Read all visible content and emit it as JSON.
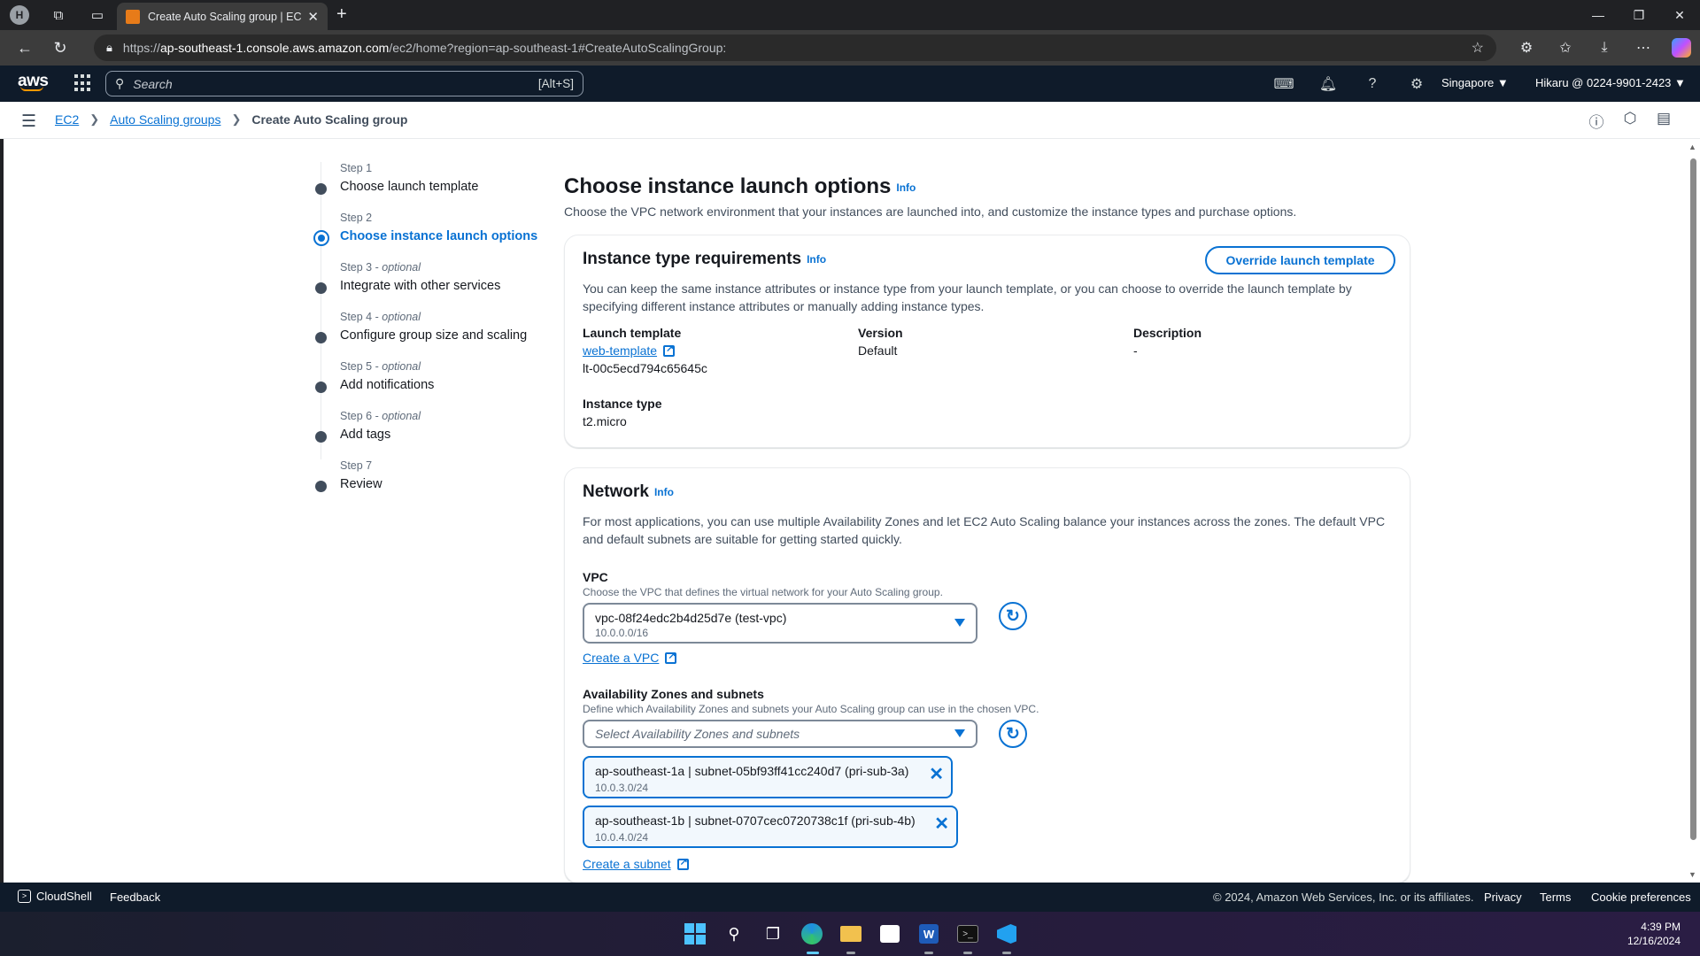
{
  "browser": {
    "tab_title": "Create Auto Scaling group | EC2 |",
    "url_prefix": "https://",
    "url_host": "ap-southeast-1.console.aws.amazon.com",
    "url_path": "/ec2/home?region=ap-southeast-1#CreateAutoScalingGroup:"
  },
  "aws_nav": {
    "logo": "aws",
    "search_placeholder": "Search",
    "search_shortcut": "[Alt+S]",
    "region": "Singapore ▼",
    "account": "Hikaru @ 0224-9901-2423 ▼"
  },
  "breadcrumb": {
    "items": [
      "EC2",
      "Auto Scaling groups"
    ],
    "current": "Create Auto Scaling group"
  },
  "steps": [
    {
      "num": "Step 1",
      "optional": "",
      "label": "Choose launch template",
      "active": false
    },
    {
      "num": "Step 2",
      "optional": "",
      "label": "Choose instance launch options",
      "active": true
    },
    {
      "num": "Step 3 - ",
      "optional": "optional",
      "label": "Integrate with other services",
      "active": false
    },
    {
      "num": "Step 4 - ",
      "optional": "optional",
      "label": "Configure group size and scaling",
      "active": false
    },
    {
      "num": "Step 5 - ",
      "optional": "optional",
      "label": "Add notifications",
      "active": false
    },
    {
      "num": "Step 6 - ",
      "optional": "optional",
      "label": "Add tags",
      "active": false
    },
    {
      "num": "Step 7",
      "optional": "",
      "label": "Review",
      "active": false
    }
  ],
  "page": {
    "title": "Choose instance launch options",
    "info": "Info",
    "subtitle": "Choose the VPC network environment that your instances are launched into, and customize the instance types and purchase options."
  },
  "instance_type": {
    "title": "Instance type requirements",
    "info": "Info",
    "override_button": "Override launch template",
    "description": "You can keep the same instance attributes or instance type from your launch template, or you can choose to override the launch template by specifying different instance attributes or manually adding instance types.",
    "launch_template_label": "Launch template",
    "launch_template_link": "web-template",
    "launch_template_id": "lt-00c5ecd794c65645c",
    "version_label": "Version",
    "version_value": "Default",
    "description_label": "Description",
    "description_value": "-",
    "instance_type_label": "Instance type",
    "instance_type_value": "t2.micro"
  },
  "network": {
    "title": "Network",
    "info": "Info",
    "description": "For most applications, you can use multiple Availability Zones and let EC2 Auto Scaling balance your instances across the zones. The default VPC and default subnets are suitable for getting started quickly.",
    "vpc_label": "VPC",
    "vpc_hint": "Choose the VPC that defines the virtual network for your Auto Scaling group.",
    "vpc_value": "vpc-08f24edc2b4d25d7e (test-vpc)",
    "vpc_cidr": "10.0.0.0/16",
    "create_vpc": "Create a VPC",
    "az_label": "Availability Zones and subnets",
    "az_hint": "Define which Availability Zones and subnets your Auto Scaling group can use in the chosen VPC.",
    "az_placeholder": "Select Availability Zones and subnets",
    "subnets": [
      {
        "name": "ap-southeast-1a | subnet-05bf93ff41cc240d7 (pri-sub-3a)",
        "cidr": "10.0.3.0/24"
      },
      {
        "name": "ap-southeast-1b | subnet-0707cec0720738c1f (pri-sub-4b)",
        "cidr": "10.0.4.0/24"
      }
    ],
    "create_subnet": "Create a subnet"
  },
  "footer": {
    "cloudshell": "CloudShell",
    "feedback": "Feedback",
    "copyright": "© 2024, Amazon Web Services, Inc. or its affiliates.",
    "privacy": "Privacy",
    "terms": "Terms",
    "cookie": "Cookie preferences"
  },
  "taskbar": {
    "time": "4:39 PM",
    "date": "12/16/2024"
  },
  "colors": {
    "link": "#0972d3",
    "aws_nav": "#0f1b2a"
  }
}
